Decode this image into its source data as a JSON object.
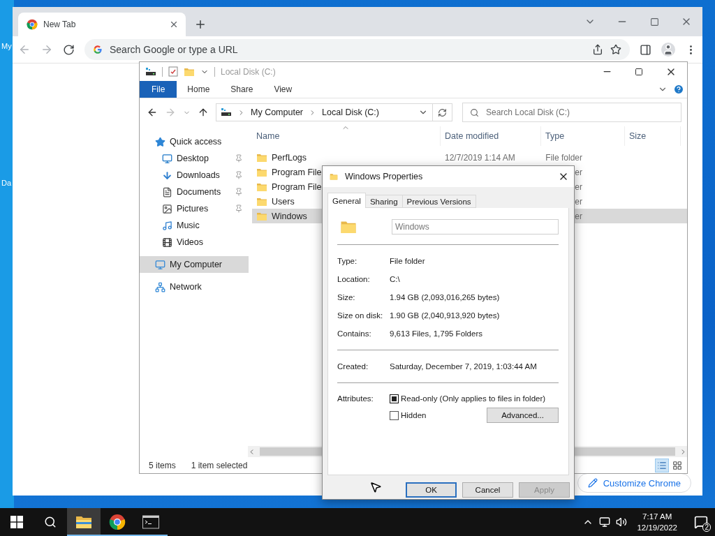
{
  "desktop": {
    "icon_labels": [
      "My",
      "Da"
    ]
  },
  "browser": {
    "tab": {
      "title": "New Tab",
      "selected": true
    },
    "omnibox": {
      "placeholder": "Search Google or type a URL"
    },
    "customize_button": "Customize Chrome"
  },
  "explorer": {
    "title": "Local Disk (C:)",
    "ribbon_tabs": [
      {
        "label": "File",
        "selected": true
      },
      {
        "label": "Home",
        "selected": false
      },
      {
        "label": "Share",
        "selected": false
      },
      {
        "label": "View",
        "selected": false
      }
    ],
    "breadcrumb": [
      "My Computer",
      "Local Disk (C:)"
    ],
    "search": {
      "placeholder": "Search Local Disk (C:)"
    },
    "nav": [
      {
        "label": "Quick access",
        "kind": "star",
        "pinned": false,
        "selected": false,
        "children": [
          {
            "label": "Desktop",
            "kind": "desktop",
            "pinned": true,
            "selected": false
          },
          {
            "label": "Downloads",
            "kind": "download",
            "pinned": true,
            "selected": false
          },
          {
            "label": "Documents",
            "kind": "document",
            "pinned": true,
            "selected": false
          },
          {
            "label": "Pictures",
            "kind": "picture",
            "pinned": true,
            "selected": false
          },
          {
            "label": "Music",
            "kind": "music",
            "pinned": false,
            "selected": false
          },
          {
            "label": "Videos",
            "kind": "video",
            "pinned": false,
            "selected": false
          }
        ]
      },
      {
        "label": "My Computer",
        "kind": "computer",
        "pinned": false,
        "selected": true
      },
      {
        "label": "Network",
        "kind": "network",
        "pinned": false,
        "selected": false
      }
    ],
    "columns": [
      "Name",
      "Date modified",
      "Type",
      "Size"
    ],
    "rows": [
      {
        "name": "PerfLogs",
        "date": "12/7/2019 1:14 AM",
        "type": "File folder",
        "selected": false
      },
      {
        "name": "Program File",
        "type": "er",
        "selected": false
      },
      {
        "name": "Program File",
        "type": "er",
        "selected": false
      },
      {
        "name": "Users",
        "type": "er",
        "selected": false
      },
      {
        "name": "Windows",
        "type": "er",
        "selected": true
      }
    ],
    "status": {
      "count": "5 items",
      "selection": "1 item selected"
    },
    "view_modes": [
      {
        "kind": "details",
        "selected": true
      },
      {
        "kind": "large-icons",
        "selected": false
      }
    ]
  },
  "dialog": {
    "title": "Windows Properties",
    "tabs": [
      {
        "label": "General",
        "selected": true
      },
      {
        "label": "Sharing",
        "selected": false
      },
      {
        "label": "Previous Versions",
        "selected": false
      }
    ],
    "name_value": "Windows",
    "groups": [
      [
        {
          "label": "Type:",
          "value": "File folder"
        },
        {
          "label": "Location:",
          "value": "C:\\"
        },
        {
          "label": "Size:",
          "value": "1.94 GB (2,093,016,265 bytes)"
        },
        {
          "label": "Size on disk:",
          "value": "1.90 GB (2,040,913,920 bytes)"
        },
        {
          "label": "Contains:",
          "value": "9,613 Files, 1,795 Folders"
        }
      ],
      [
        {
          "label": "Created:",
          "value": "Saturday, December 7, 2019, 1:03:44 AM"
        }
      ]
    ],
    "attributes": {
      "label": "Attributes:",
      "options": [
        {
          "label": "Read-only (Only applies to files in folder)",
          "checked": true,
          "indeterminate": true
        },
        {
          "label": "Hidden",
          "checked": false,
          "indeterminate": false
        }
      ],
      "advanced": "Advanced..."
    },
    "buttons": [
      {
        "label": "OK",
        "default": true,
        "disabled": false
      },
      {
        "label": "Cancel",
        "default": false,
        "disabled": false
      },
      {
        "label": "Apply",
        "default": false,
        "disabled": true
      }
    ]
  },
  "taskbar": {
    "apps": [
      {
        "kind": "explorer",
        "active": true
      },
      {
        "kind": "chrome",
        "active": false
      },
      {
        "kind": "terminal",
        "active": false
      }
    ],
    "time": "7:17 AM",
    "date": "12/19/2022",
    "notifications": "2"
  }
}
